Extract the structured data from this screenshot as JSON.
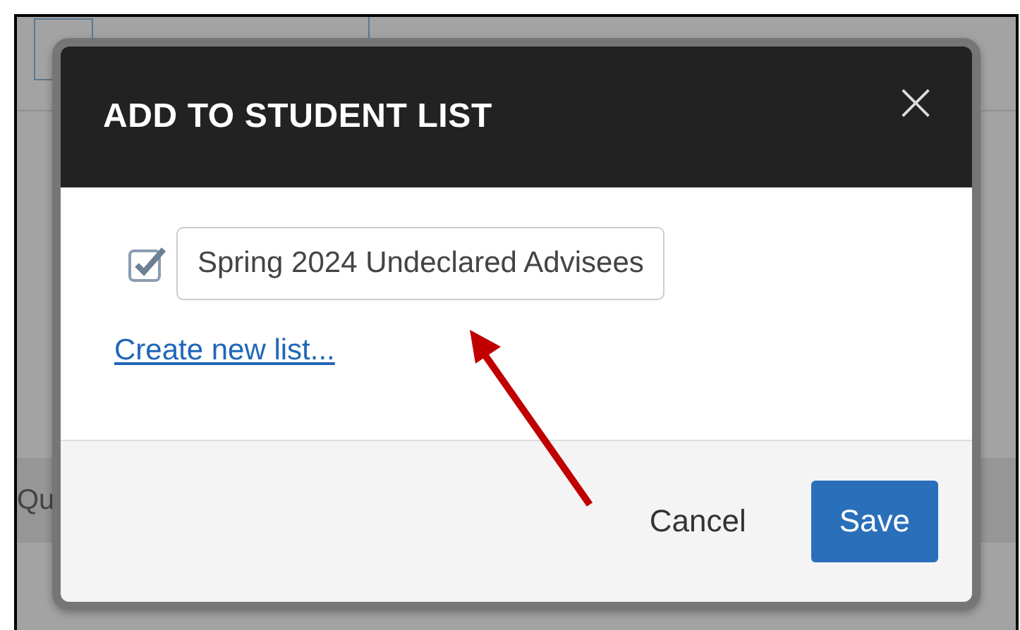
{
  "background": {
    "row_label": "Qu"
  },
  "dialog": {
    "title": "ADD TO STUDENT LIST",
    "close": "×",
    "lists": [
      {
        "name": "Spring 2024 Undeclared Advisees",
        "checked": true
      }
    ],
    "create_link": "Create new list...",
    "buttons": [
      {
        "label": "Cancel",
        "kind": "link"
      },
      {
        "label": "Save",
        "kind": "primary"
      }
    ]
  },
  "annotation": {
    "kind": "arrow",
    "color": "#c00000"
  }
}
